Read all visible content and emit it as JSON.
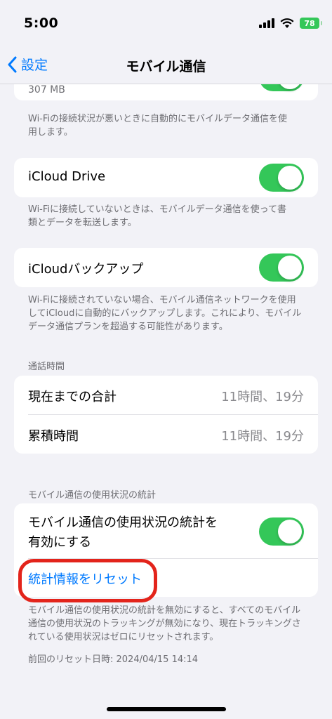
{
  "status_bar": {
    "time": "5:00",
    "battery": "78"
  },
  "nav": {
    "back_label": "設定",
    "title": "モバイル通信"
  },
  "top_partial": {
    "value": "307 MB"
  },
  "wifi_assist": {
    "footnote": "Wi-Fiの接続状況が悪いときに自動的にモバイルデータ通信を使用します。"
  },
  "icloud_drive": {
    "label": "iCloud Drive",
    "footnote": "Wi-Fiに接続していないときは、モバイルデータ通信を使って書類とデータを転送します。"
  },
  "icloud_backup": {
    "label": "iCloudバックアップ",
    "footnote": "Wi-Fiに接続されていない場合、モバイル通信ネットワークを使用してiCloudに自動的にバックアップします。これにより、モバイルデータ通信プランを超過する可能性があります。"
  },
  "call_time": {
    "header": "通話時間",
    "rows": [
      {
        "label": "現在までの合計",
        "value": "11時間、19分"
      },
      {
        "label": "累積時間",
        "value": "11時間、19分"
      }
    ]
  },
  "usage_stats": {
    "header": "モバイル通信の使用状況の統計",
    "toggle_label_line1": "モバイル通信の使用状況の統計を",
    "toggle_label_line2": "有効にする",
    "reset_label": "統計情報をリセット",
    "footnote": "モバイル通信の使用状況の統計を無効にすると、すべてのモバイル通信の使用状況のトラッキングが無効になり、現在トラッキングされている使用状況はゼロにリセットされます。",
    "last_reset": "前回のリセット日時: 2024/04/15 14:14"
  },
  "colors": {
    "accent": "#007aff",
    "toggle_on": "#34c759",
    "highlight": "#e3241b"
  }
}
